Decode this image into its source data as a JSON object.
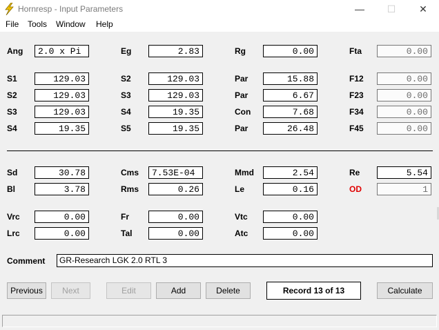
{
  "window": {
    "title": "Hornresp - Input Parameters",
    "icon": "lightning-bolt-icon",
    "accent": "#f0c000"
  },
  "menu": [
    "File",
    "Tools",
    "Window",
    "Help"
  ],
  "fields": {
    "ang": {
      "label": "Ang",
      "value": "2.0 x Pi"
    },
    "eg": {
      "label": "Eg",
      "value": "2.83"
    },
    "rg": {
      "label": "Rg",
      "value": "0.00"
    },
    "fta": {
      "label": "Fta",
      "value": "0.00"
    },
    "s1": {
      "label": "S1",
      "value": "129.03"
    },
    "s2a": {
      "label": "S2",
      "value": "129.03"
    },
    "par1": {
      "label": "Par",
      "value": "15.88"
    },
    "f12": {
      "label": "F12",
      "value": "0.00"
    },
    "s2b": {
      "label": "S2",
      "value": "129.03"
    },
    "s3a": {
      "label": "S3",
      "value": "129.03"
    },
    "par2": {
      "label": "Par",
      "value": "6.67"
    },
    "f23": {
      "label": "F23",
      "value": "0.00"
    },
    "s3b": {
      "label": "S3",
      "value": "129.03"
    },
    "s4a": {
      "label": "S4",
      "value": "19.35"
    },
    "con": {
      "label": "Con",
      "value": "7.68"
    },
    "f34": {
      "label": "F34",
      "value": "0.00"
    },
    "s4b": {
      "label": "S4",
      "value": "19.35"
    },
    "s5": {
      "label": "S5",
      "value": "19.35"
    },
    "par3": {
      "label": "Par",
      "value": "26.48"
    },
    "f45": {
      "label": "F45",
      "value": "0.00"
    },
    "sd": {
      "label": "Sd",
      "value": "30.78"
    },
    "cms": {
      "label": "Cms",
      "value": "7.53E-04"
    },
    "mmd": {
      "label": "Mmd",
      "value": "2.54"
    },
    "re": {
      "label": "Re",
      "value": "5.54"
    },
    "bl": {
      "label": "Bl",
      "value": "3.78"
    },
    "rms": {
      "label": "Rms",
      "value": "0.26"
    },
    "le": {
      "label": "Le",
      "value": "0.16"
    },
    "od": {
      "label": "OD",
      "value": "1"
    },
    "vrc": {
      "label": "Vrc",
      "value": "0.00"
    },
    "fr": {
      "label": "Fr",
      "value": "0.00"
    },
    "vtc": {
      "label": "Vtc",
      "value": "0.00"
    },
    "lrc": {
      "label": "Lrc",
      "value": "0.00"
    },
    "tal": {
      "label": "Tal",
      "value": "0.00"
    },
    "atc": {
      "label": "Atc",
      "value": "0.00"
    }
  },
  "comment": {
    "label": "Comment",
    "value": "GR-Research LGK 2.0 RTL 3"
  },
  "buttons": {
    "previous": "Previous",
    "next": "Next",
    "edit": "Edit",
    "add": "Add",
    "delete": "Delete",
    "calculate": "Calculate"
  },
  "record": "Record 13 of 13",
  "colors": {
    "od_label": "#e00000"
  }
}
